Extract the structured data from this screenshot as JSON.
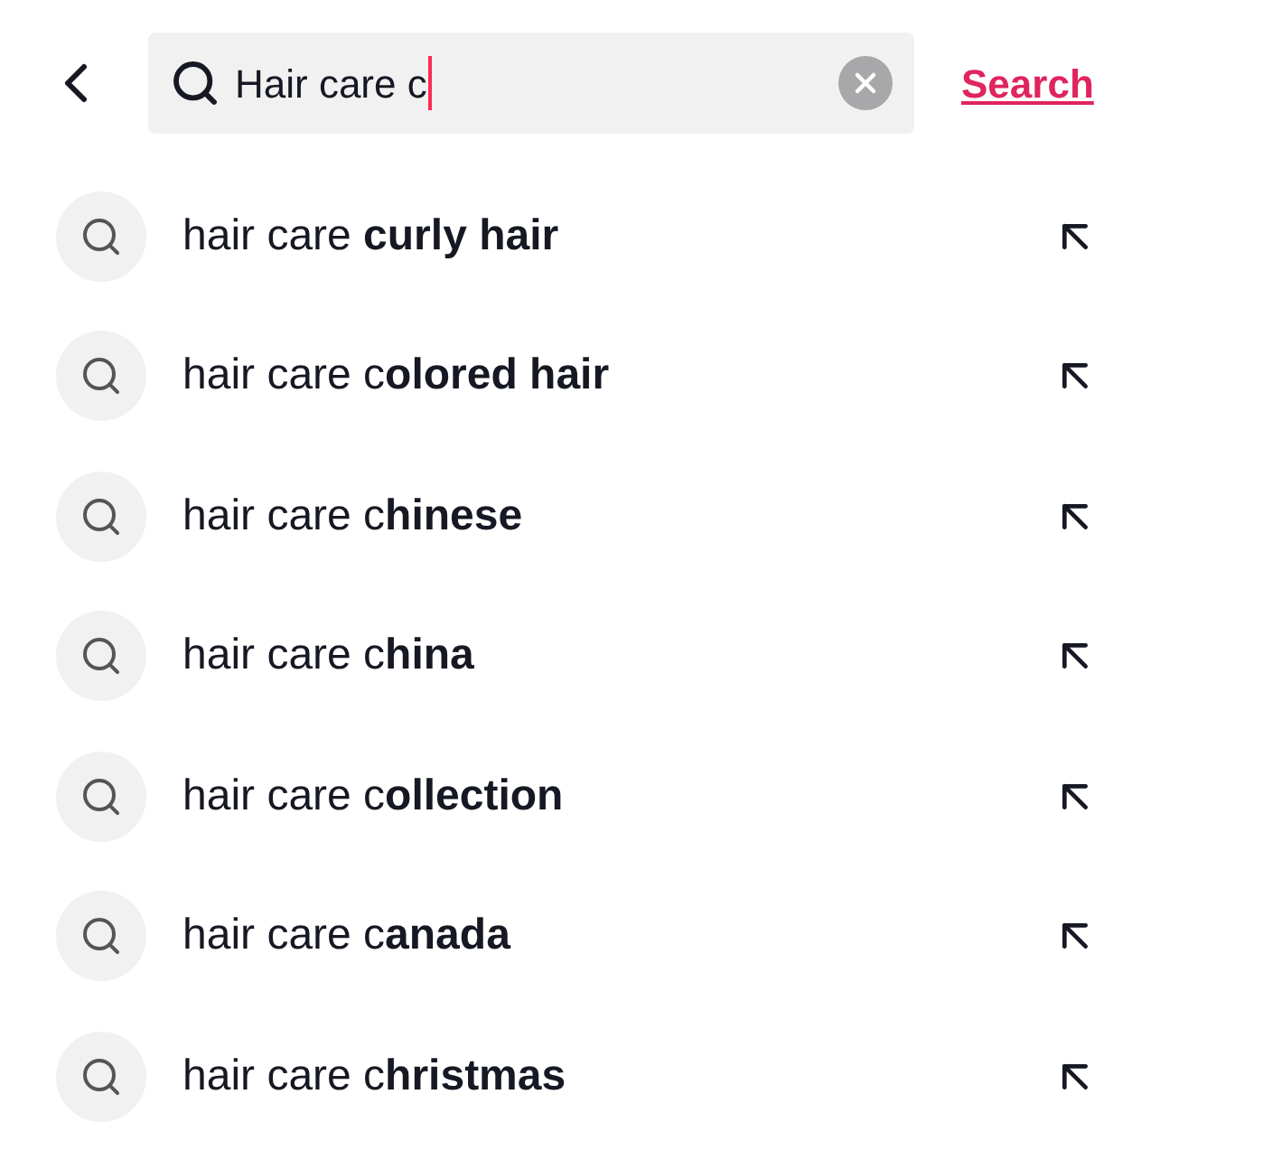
{
  "search": {
    "value": "Hair care c",
    "button": "Search"
  },
  "suggestions": [
    {
      "text": "hair care **curly hair**"
    },
    {
      "text": "hair care c**olored hair**"
    },
    {
      "text": "hair care c**hinese**"
    },
    {
      "text": "hair care c**hina**"
    },
    {
      "text": "hair care c**ollection**"
    },
    {
      "text": "hair care c**anada**"
    },
    {
      "text": "hair care c**hristmas**"
    }
  ]
}
